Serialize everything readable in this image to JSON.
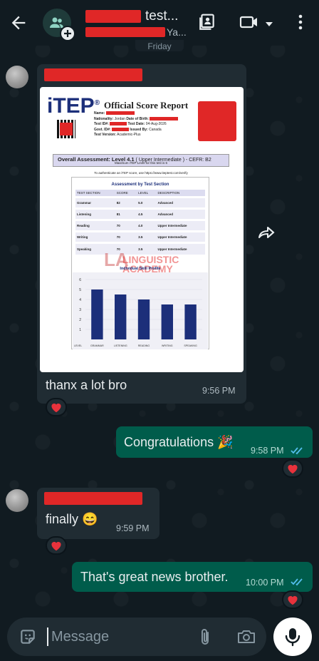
{
  "header": {
    "title": "test...",
    "subtitle": "Ya...",
    "icons": [
      "back-arrow-icon",
      "group-avatar-icon",
      "add-icon",
      "contact-card-icon",
      "video-call-icon",
      "dropdown-caret-icon",
      "more-options-icon"
    ]
  },
  "date_chip": "Friday",
  "messages": {
    "m1": {
      "image": {
        "logo": "iTEP",
        "title": "Official Score Report",
        "fields": {
          "name_label": "Name:",
          "nationality_label": "Nationality:",
          "nationality_value": "Jordan",
          "dob_label": "Date of Birth:",
          "test_id_label": "Test ID#:",
          "test_date_label": "Test Date:",
          "test_date_value": "04-Aug-2026",
          "govt_id_label": "Govt. ID#:",
          "issued_by_label": "Issued By:",
          "issued_by_value": "Canada",
          "version_label": "Test Version:",
          "version_value": "Academic-Plus"
        },
        "overall": {
          "prefix": "Overall Assessment:",
          "level": "Level 4.1",
          "level_desc": "( Upper Intermediate ) - CEFR: B2",
          "max_note": "Maximum iTEP Level for this test is 6"
        },
        "auth_note": "To authenticate an iTEP score, use https://www.iteptest.com/verify",
        "section_title": "Assessment by Test Section",
        "table_headers": [
          "TEST SECTION",
          "SCORE",
          "LEVEL",
          "DESCRIPTION"
        ],
        "table_rows": [
          [
            "Grammar",
            "82",
            "5.0",
            "Advanced"
          ],
          [
            "Listening",
            "81",
            "4.5",
            "Advanced"
          ],
          [
            "Reading",
            "70",
            "4.0",
            "Upper Intermediate"
          ],
          [
            "Writing",
            "70",
            "3.5",
            "Upper Intermediate"
          ],
          [
            "Speaking",
            "70",
            "3.5",
            "Upper Intermediate"
          ]
        ],
        "watermark": {
          "line1": "LINGUISTIC",
          "line2": "ACADEMY"
        },
        "chart_title": "Individual Skill Profile"
      },
      "text": "thanx a lot bro",
      "time": "9:56 PM",
      "reaction": "heart"
    },
    "m2": {
      "text": "Congratulations 🎉",
      "time": "9:58 PM",
      "reaction": "heart"
    },
    "m3": {
      "text": "finally 😄",
      "time": "9:59 PM",
      "reaction": "heart"
    },
    "m4": {
      "text": "That's great news brother.",
      "time": "10:00 PM",
      "reaction": "heart"
    }
  },
  "composer": {
    "placeholder": "Message",
    "icons": [
      "sticker-icon",
      "attach-icon",
      "camera-icon",
      "mic-icon"
    ]
  },
  "colors": {
    "incoming": "#202c33",
    "outgoing": "#005c4b",
    "tick": "#53bdeb",
    "redaction": "#e02727"
  },
  "chart_data": {
    "type": "bar",
    "title": "Individual Skill Profile",
    "ylabel": "LEVEL",
    "categories": [
      "GRAMMAR",
      "LISTENING",
      "READING",
      "WRITING",
      "SPEAKING"
    ],
    "values": [
      5.0,
      4.5,
      4.0,
      3.5,
      3.5
    ],
    "yticks": [
      "1",
      "2",
      "3",
      "4",
      "5",
      "6"
    ],
    "ylim": [
      0,
      6
    ],
    "color": "#1c2f7a"
  }
}
